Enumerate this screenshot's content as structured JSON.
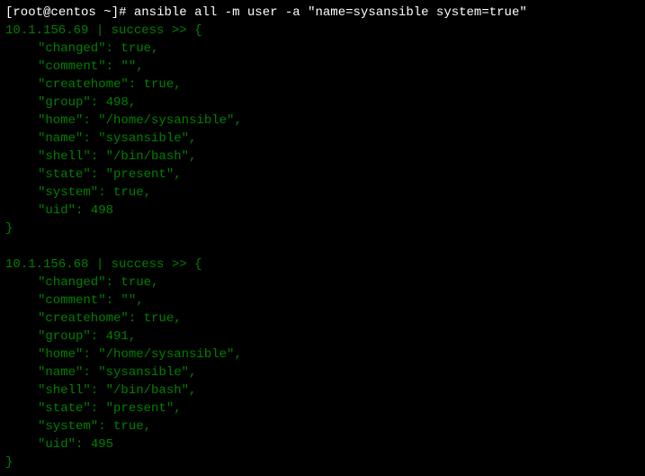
{
  "prompt": {
    "user": "root",
    "host": "centos",
    "path": "~",
    "symbol": "#",
    "command": "ansible all -m user -a \"name=sysansible system=true\""
  },
  "results": [
    {
      "ip": "10.1.156.69",
      "status": "success",
      "data": {
        "changed": "true",
        "comment": "\"\"",
        "createhome": "true",
        "group": "498",
        "home": "\"/home/sysansible\"",
        "name": "\"sysansible\"",
        "shell": "\"/bin/bash\"",
        "state": "\"present\"",
        "system": "true",
        "uid": "498"
      }
    },
    {
      "ip": "10.1.156.68",
      "status": "success",
      "data": {
        "changed": "true",
        "comment": "\"\"",
        "createhome": "true",
        "group": "491",
        "home": "\"/home/sysansible\"",
        "name": "\"sysansible\"",
        "shell": "\"/bin/bash\"",
        "state": "\"present\"",
        "system": "true",
        "uid": "495"
      }
    }
  ]
}
